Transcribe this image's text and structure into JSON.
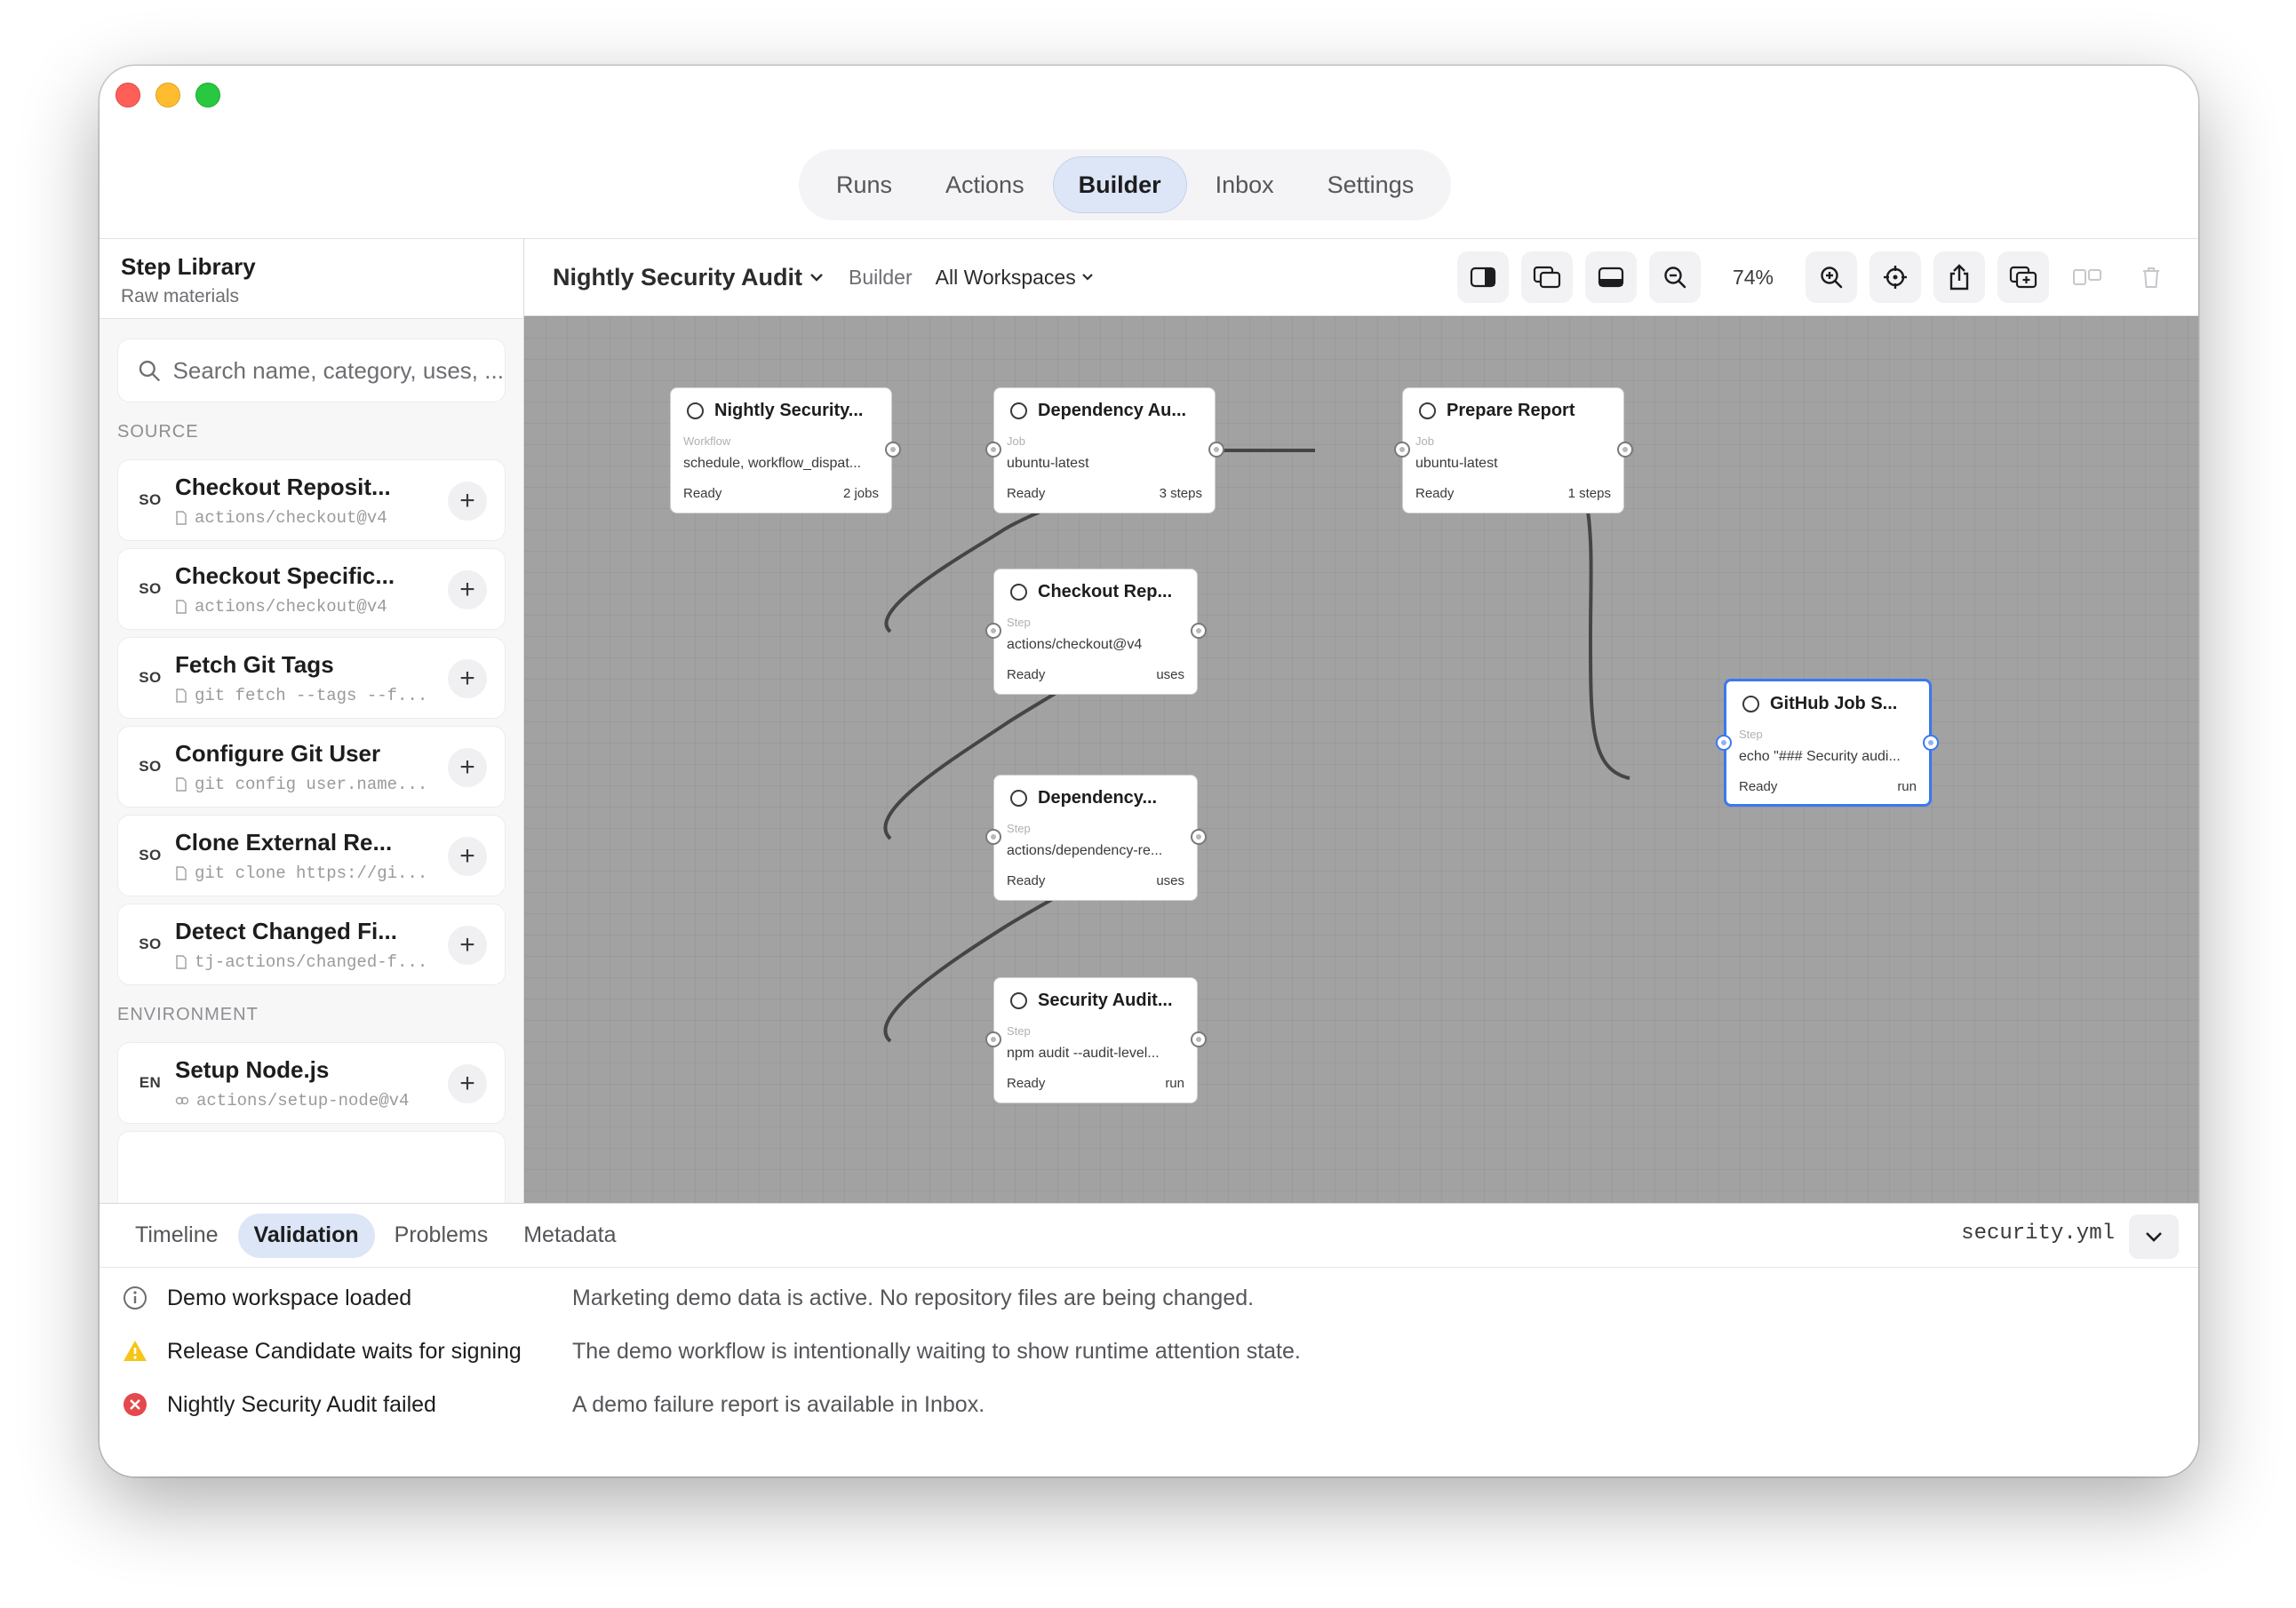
{
  "nav": {
    "tabs": [
      {
        "label": "Runs",
        "active": false
      },
      {
        "label": "Actions",
        "active": false
      },
      {
        "label": "Builder",
        "active": true
      },
      {
        "label": "Inbox",
        "active": false
      },
      {
        "label": "Settings",
        "active": false
      }
    ]
  },
  "sidebar": {
    "title": "Step Library",
    "subtitle": "Raw materials",
    "search_placeholder": "Search name, category, uses, ...",
    "sections": [
      {
        "label": "SOURCE",
        "items": [
          {
            "badge": "SO",
            "name": "Checkout Reposit...",
            "uses": "actions/checkout@v4"
          },
          {
            "badge": "SO",
            "name": "Checkout Specific...",
            "uses": "actions/checkout@v4"
          },
          {
            "badge": "SO",
            "name": "Fetch Git Tags",
            "uses": "git fetch --tags --f..."
          },
          {
            "badge": "SO",
            "name": "Configure Git User",
            "uses": "git config user.name..."
          },
          {
            "badge": "SO",
            "name": "Clone External Re...",
            "uses": "git clone https://gi..."
          },
          {
            "badge": "SO",
            "name": "Detect Changed Fi...",
            "uses": "tj-actions/changed-f..."
          }
        ]
      },
      {
        "label": "ENVIRONMENT",
        "items": [
          {
            "badge": "EN",
            "name": "Setup Node.js",
            "uses": "actions/setup-node@v4"
          }
        ]
      }
    ]
  },
  "toolbar": {
    "workflow_name": "Nightly Security Audit",
    "mode": "Builder",
    "workspace": "All Workspaces",
    "zoom": "74%"
  },
  "canvas": {
    "nodes": [
      {
        "title": "Nightly Security...",
        "kind": "Workflow",
        "detail": "schedule, workflow_dispat...",
        "status": "Ready",
        "meta": "2 jobs"
      },
      {
        "title": "Dependency Au...",
        "kind": "Job",
        "detail": "ubuntu-latest",
        "status": "Ready",
        "meta": "3 steps"
      },
      {
        "title": "Prepare Report",
        "kind": "Job",
        "detail": "ubuntu-latest",
        "status": "Ready",
        "meta": "1 steps"
      },
      {
        "title": "Checkout Rep...",
        "kind": "Step",
        "detail": "actions/checkout@v4",
        "status": "Ready",
        "meta": "uses"
      },
      {
        "title": "Dependency...",
        "kind": "Step",
        "detail": "actions/dependency-re...",
        "status": "Ready",
        "meta": "uses"
      },
      {
        "title": "Security Audit...",
        "kind": "Step",
        "detail": "npm audit --audit-level...",
        "status": "Ready",
        "meta": "run"
      },
      {
        "title": "GitHub Job S...",
        "kind": "Step",
        "detail": "echo \"### Security audi...",
        "status": "Ready",
        "meta": "run"
      }
    ]
  },
  "bottom": {
    "tabs": [
      {
        "label": "Timeline",
        "active": false
      },
      {
        "label": "Validation",
        "active": true
      },
      {
        "label": "Problems",
        "active": false
      },
      {
        "label": "Metadata",
        "active": false
      }
    ],
    "file": "security.yml",
    "messages": [
      {
        "icon": "info-icon",
        "title": "Demo workspace loaded",
        "desc": "Marketing demo data is active. No repository files are being changed."
      },
      {
        "icon": "warning-icon",
        "title": "Release Candidate waits for signing",
        "desc": "The demo workflow is intentionally waiting to show runtime attention state."
      },
      {
        "icon": "error-icon",
        "title": "Nightly Security Audit failed",
        "desc": "A demo failure report is available in Inbox."
      }
    ]
  },
  "colors": {
    "accent": "#3a78f2",
    "active_tab": "#dde6f7",
    "canvas": "#a2a2a2",
    "warning": "#f5c518",
    "error": "#e5484d"
  }
}
